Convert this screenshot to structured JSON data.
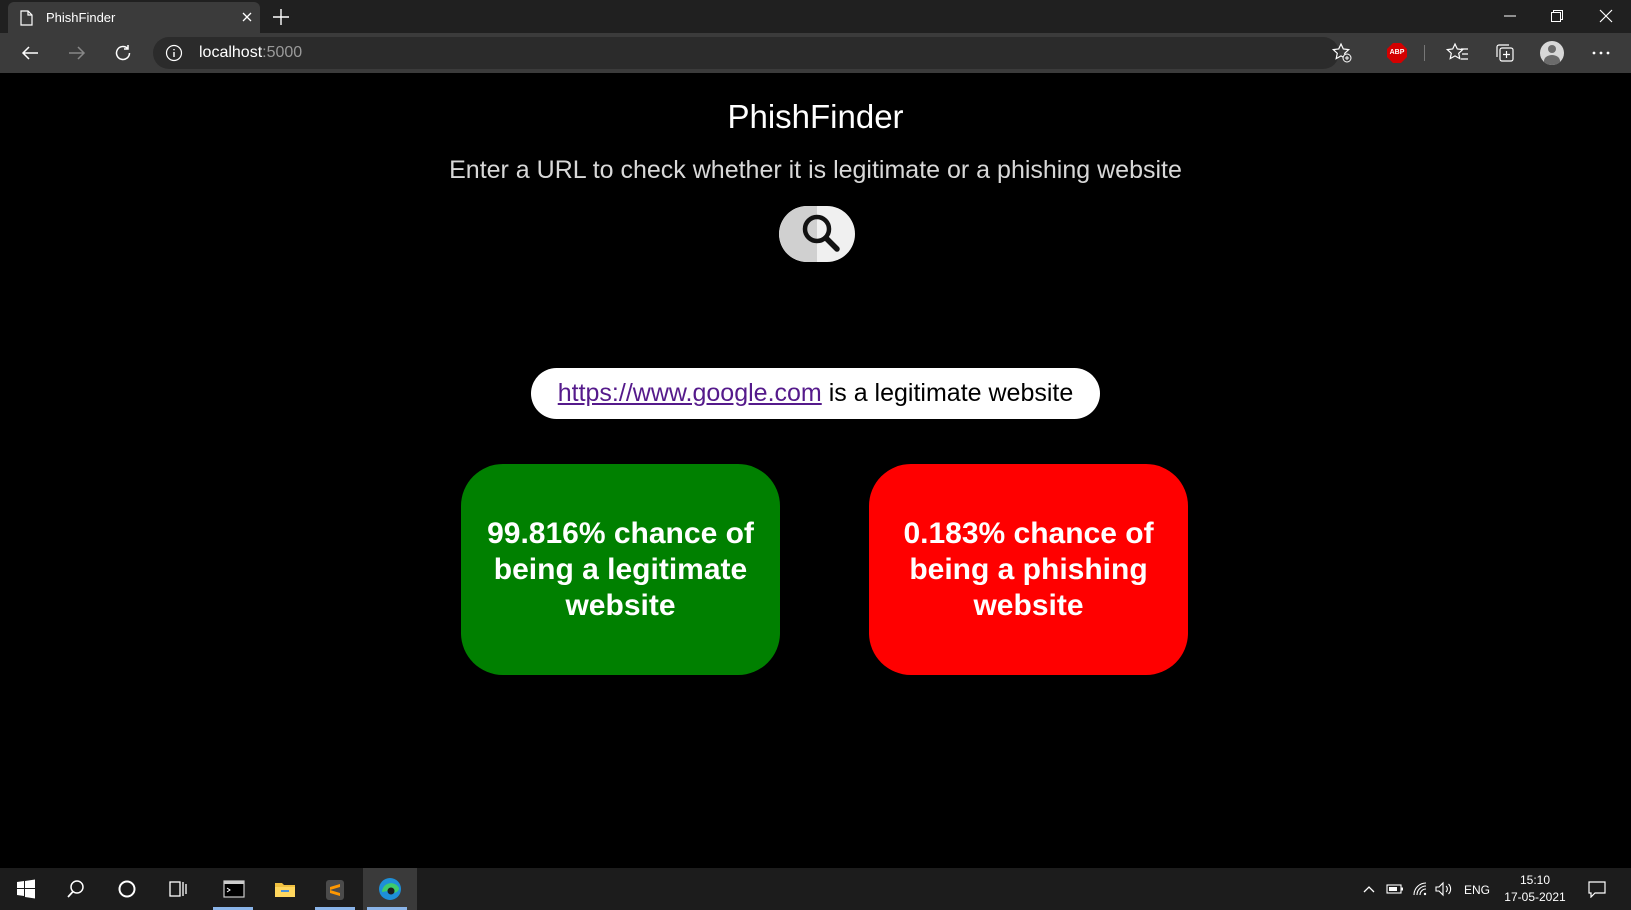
{
  "browser": {
    "tab_title": "PhishFinder",
    "url_host": "localhost",
    "url_port": ":5000",
    "abp_label": "ABP"
  },
  "page": {
    "title": "PhishFinder",
    "subtitle": "Enter a URL to check whether it is legitimate or a phishing website",
    "result": {
      "link": "https://www.google.com",
      "verdict": " is a legitimate website"
    },
    "legit_card": {
      "text": "99.816% chance of being a legitimate website",
      "color": "#008000"
    },
    "phish_card": {
      "text": "0.183% chance of being a phishing website",
      "color": "#ff0000"
    }
  },
  "taskbar": {
    "apps": [
      "start-icon",
      "search-icon",
      "cortana-icon",
      "task-view-icon",
      "terminal-icon",
      "file-explorer-icon",
      "sublime-text-icon",
      "edge-icon"
    ],
    "language": "ENG",
    "time": "15:10",
    "date": "17-05-2021"
  }
}
